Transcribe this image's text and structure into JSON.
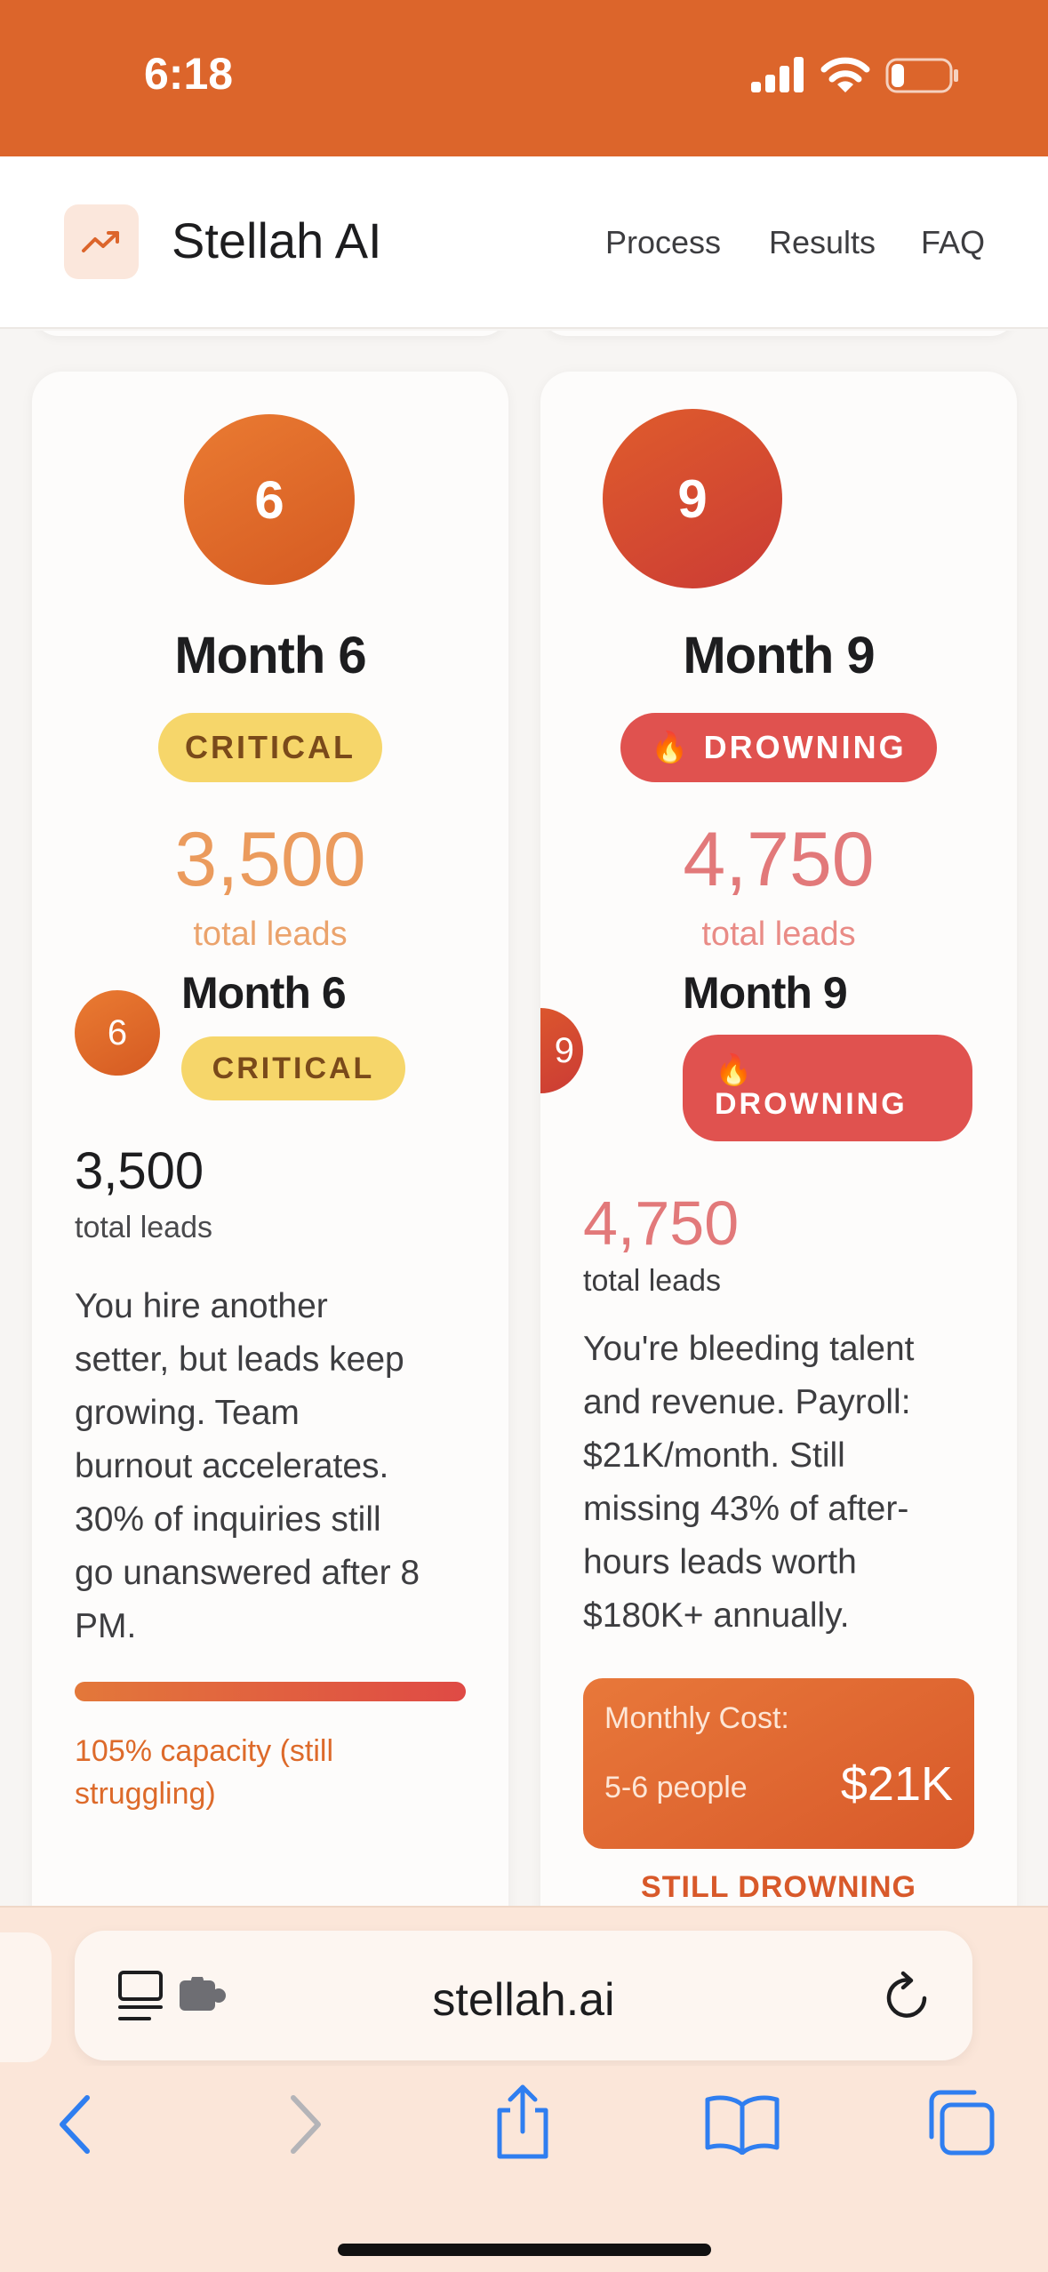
{
  "status_bar": {
    "time": "6:18"
  },
  "nav": {
    "brand": "Stellah AI",
    "links": [
      "Process",
      "Results",
      "FAQ"
    ]
  },
  "cards": [
    {
      "number": "6",
      "title": "Month 6",
      "badge": "CRITICAL",
      "leads": "3,500",
      "leads_label": "total leads",
      "small": {
        "number": "6",
        "title": "Month 6",
        "badge": "CRITICAL",
        "leads": "3,500",
        "leads_label": "total leads"
      },
      "body_lines": [
        "You hire another",
        "setter, but leads keep",
        "growing. Team",
        "burnout accelerates.",
        "30% of inquiries still",
        "go unanswered after 8",
        "PM."
      ],
      "capacity_lines": [
        "105% capacity (still",
        "struggling)"
      ],
      "capacity_percent": 105
    },
    {
      "number": "9",
      "title": "Month 9",
      "badge_emoji": "🔥",
      "badge": "DROWNING",
      "leads": "4,750",
      "leads_label": "total leads",
      "small": {
        "number": "9",
        "title": "Month 9",
        "badge_emoji": "🔥",
        "badge": "DROWNING",
        "leads": "4,750",
        "leads_label": "total leads"
      },
      "body_lines": [
        "You're bleeding talent",
        "and revenue. Payroll:",
        "$21K/month. Still",
        "missing 43% of after-",
        "hours leads worth",
        "$180K+ annually."
      ],
      "cost": {
        "label": "Monthly Cost:",
        "people": "5-6 people",
        "value": "$21K"
      },
      "footer": "STILL DROWNING"
    }
  ],
  "browser": {
    "url": "stellah.ai"
  },
  "colors": {
    "accent": "#dc652b",
    "critical": "#f6d66a",
    "drowning": "#e0524f"
  }
}
